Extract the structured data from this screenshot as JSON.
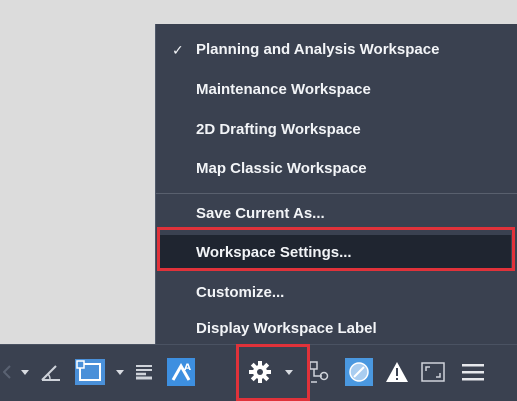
{
  "menu": {
    "items": [
      {
        "label": "Planning and Analysis Workspace",
        "checked": true
      },
      {
        "label": "Maintenance Workspace",
        "checked": false
      },
      {
        "label": "2D Drafting Workspace",
        "checked": false
      },
      {
        "label": "Map Classic Workspace",
        "checked": false
      },
      {
        "label": "Save Current As...",
        "checked": false
      },
      {
        "label": "Workspace Settings...",
        "checked": false,
        "highlighted": true
      },
      {
        "label": "Customize...",
        "checked": false
      },
      {
        "label": "Display Workspace Label",
        "checked": false
      }
    ],
    "check_glyph": "✓"
  },
  "statusbar": {
    "icons": [
      "caret-down-icon",
      "polar-angle-icon",
      "object-snap-icon",
      "caret-down-icon",
      "lineweight-icon",
      "annotation-scale-icon",
      "workspace-gear-icon",
      "caret-down-icon",
      "units-icon",
      "isolate-objects-icon",
      "warning-icon",
      "fullscreen-icon",
      "hamburger-menu-icon"
    ]
  },
  "colors": {
    "menu_bg": "#3a4150",
    "highlight_bg": "#1f2530",
    "annotation_red": "#e0323a",
    "text": "#f2f4f7",
    "accent_blue": "#3d8fe0"
  }
}
